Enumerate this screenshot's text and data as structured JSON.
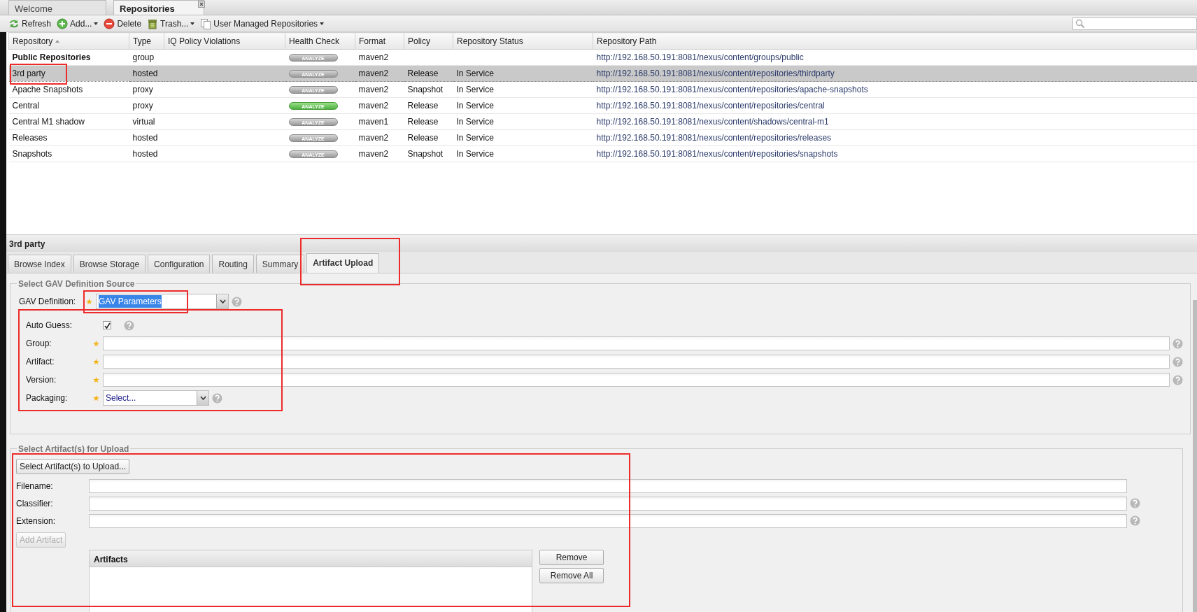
{
  "tabs": [
    {
      "label": "Welcome",
      "selected": false,
      "closable": false
    },
    {
      "label": "Repositories",
      "selected": true,
      "closable": true
    }
  ],
  "toolbar": [
    {
      "label": "Refresh",
      "menu": false
    },
    {
      "label": "Add...",
      "menu": true
    },
    {
      "label": "Delete",
      "menu": false
    },
    {
      "label": "Trash...",
      "menu": true
    },
    {
      "label": "User Managed Repositories",
      "menu": true
    }
  ],
  "table": {
    "columns": [
      {
        "label": "Repository",
        "sorted": true
      },
      {
        "label": "Type",
        "sorted": false
      },
      {
        "label": "IQ Policy Violations",
        "sorted": false
      },
      {
        "label": "Health Check",
        "sorted": false
      },
      {
        "label": "Format",
        "sorted": false
      },
      {
        "label": "Policy",
        "sorted": false
      },
      {
        "label": "Repository Status",
        "sorted": false
      },
      {
        "label": "Repository Path",
        "sorted": false
      }
    ],
    "rows": [
      {
        "name": "Public Repositories",
        "bold": true,
        "selected": false,
        "annotated": false,
        "type": "group",
        "health": {
          "label": "ANALYZE",
          "on": false
        },
        "format": "maven2",
        "path": "http://192.168.50.191:8081/nexus/content/groups/public"
      },
      {
        "name": "3rd party",
        "bold": false,
        "selected": true,
        "annotated": true,
        "type": "hosted",
        "health": {
          "label": "ANALYZE",
          "on": false
        },
        "format": "maven2",
        "policy": "Release",
        "status": "In Service",
        "path": "http://192.168.50.191:8081/nexus/content/repositories/thirdparty"
      },
      {
        "name": "Apache Snapshots",
        "bold": false,
        "selected": false,
        "annotated": false,
        "type": "proxy",
        "health": {
          "label": "ANALYZE",
          "on": false
        },
        "format": "maven2",
        "policy": "Snapshot",
        "status": "In Service",
        "path": "http://192.168.50.191:8081/nexus/content/repositories/apache-snapshots"
      },
      {
        "name": "Central",
        "bold": false,
        "selected": false,
        "annotated": false,
        "type": "proxy",
        "health": {
          "label": "ANALYZE",
          "on": true
        },
        "format": "maven2",
        "policy": "Release",
        "status": "In Service",
        "path": "http://192.168.50.191:8081/nexus/content/repositories/central"
      },
      {
        "name": "Central M1 shadow",
        "bold": false,
        "selected": false,
        "annotated": false,
        "type": "virtual",
        "health": {
          "label": "ANALYZE",
          "on": false
        },
        "format": "maven1",
        "policy": "Release",
        "status": "In Service",
        "path": "http://192.168.50.191:8081/nexus/content/shadows/central-m1"
      },
      {
        "name": "Releases",
        "bold": false,
        "selected": false,
        "annotated": false,
        "type": "hosted",
        "health": {
          "label": "ANALYZE",
          "on": false
        },
        "format": "maven2",
        "policy": "Release",
        "status": "In Service",
        "path": "http://192.168.50.191:8081/nexus/content/repositories/releases"
      },
      {
        "name": "Snapshots",
        "bold": false,
        "selected": false,
        "annotated": false,
        "type": "hosted",
        "health": {
          "label": "ANALYZE",
          "on": false
        },
        "format": "maven2",
        "policy": "Snapshot",
        "status": "In Service",
        "path": "http://192.168.50.191:8081/nexus/content/repositories/snapshots"
      }
    ]
  },
  "detail": {
    "title": "3rd party",
    "tabs": [
      {
        "label": "Browse Index",
        "selected": false,
        "annotated": false
      },
      {
        "label": "Browse Storage",
        "selected": false,
        "annotated": false
      },
      {
        "label": "Configuration",
        "selected": false,
        "annotated": false
      },
      {
        "label": "Routing",
        "selected": false,
        "annotated": false
      },
      {
        "label": "Summary",
        "selected": false,
        "annotated": false
      },
      {
        "label": "Artifact Upload",
        "selected": true,
        "annotated": true
      }
    ],
    "gav_section": {
      "legend": "Select GAV Definition Source",
      "definition": {
        "label": "GAV Definition:",
        "value": "GAV Parameters",
        "required": true,
        "text_selected": true,
        "annotated": true
      },
      "fields_annotated": true,
      "fields": [
        {
          "kind": "checkbox",
          "label": "Auto Guess:",
          "required": false,
          "checked": true,
          "help": true
        },
        {
          "kind": "text",
          "label": "Group:",
          "required": true,
          "help": true
        },
        {
          "kind": "text",
          "label": "Artifact:",
          "required": true,
          "help": true
        },
        {
          "kind": "text",
          "label": "Version:",
          "required": true,
          "help": true
        },
        {
          "kind": "combo",
          "label": "Packaging:",
          "required": true,
          "value": "Select...",
          "help": true
        }
      ]
    },
    "upload_section": {
      "legend": "Select Artifact(s) for Upload",
      "annotated": true,
      "select_button": "Select Artifact(s) to Upload...",
      "fields": [
        {
          "label": "Filename:",
          "help": false
        },
        {
          "label": "Classifier:",
          "help": true
        },
        {
          "label": "Extension:",
          "help": true
        }
      ],
      "add_button": {
        "label": "Add Artifact",
        "disabled": true
      },
      "grid_title": "Artifacts",
      "buttons": [
        "Remove",
        "Remove All"
      ]
    }
  }
}
